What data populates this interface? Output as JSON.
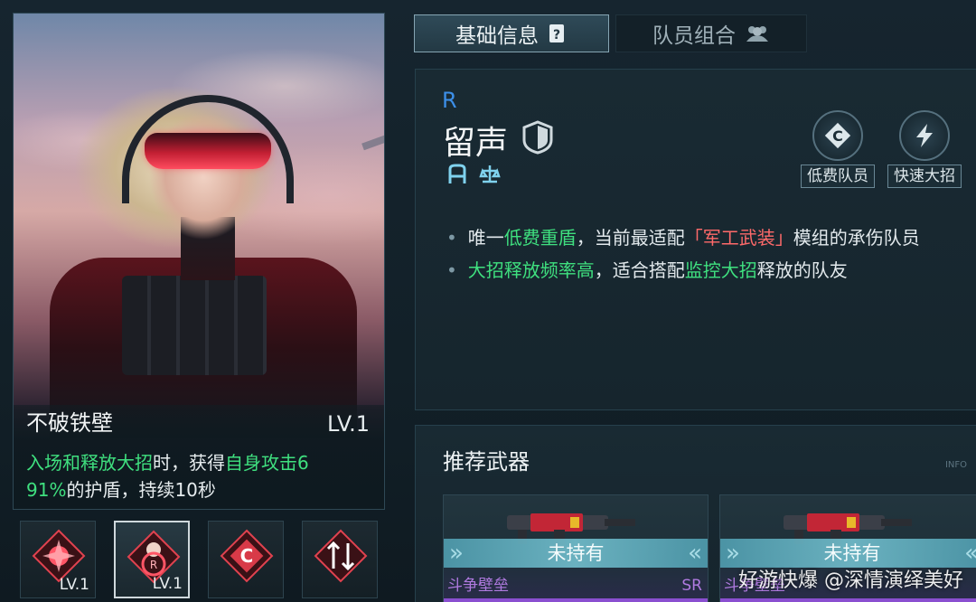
{
  "tabs": [
    {
      "label": "基础信息",
      "icon": "document-icon",
      "active": true
    },
    {
      "label": "队员组合",
      "icon": "team-icon",
      "active": false
    }
  ],
  "skill": {
    "name": "不破铁壁",
    "level": "LV.1",
    "desc_parts": [
      "入场和释放大招",
      "时，获得",
      "自身攻击6",
      "91%",
      "的护盾，持续10秒"
    ]
  },
  "skill_slots": [
    {
      "icon": "burst-skill-icon",
      "level": "LV.1"
    },
    {
      "icon": "portrait-skill-icon",
      "level": "LV.1"
    },
    {
      "icon": "c-badge-icon",
      "level": ""
    },
    {
      "icon": "arrows-skill-icon",
      "level": ""
    }
  ],
  "character": {
    "rarity": "R",
    "name": "留声",
    "role_icons": [
      "a-role-icon",
      "balance-role-icon"
    ],
    "tags": [
      {
        "label": "低费队员",
        "icon": "c-emblem-icon"
      },
      {
        "label": "快速大招",
        "icon": "lightning-icon"
      }
    ],
    "desc": [
      {
        "parts": [
          "唯一",
          "低费重盾",
          "，当前最适配",
          "「军工武装」",
          "模组的承伤队员"
        ]
      },
      {
        "parts": [
          "大招释放频率高",
          "，适合搭配",
          "监控大招",
          "释放的队友"
        ]
      }
    ]
  },
  "weapons": {
    "title": "推荐武器",
    "info": "INFO",
    "items": [
      {
        "status": "未持有",
        "name": "斗争壁垒",
        "rarity": "SR"
      },
      {
        "status": "未持有",
        "name": "斗争壁垒",
        "rarity": ""
      }
    ]
  },
  "watermark": "好游快爆 @深情演绎美好",
  "colors": {
    "highlight_green": "#3fe07f",
    "highlight_red": "#ff6a6a",
    "rarity_blue": "#3c8fe8",
    "weapon_purple": "#b07ae0"
  }
}
